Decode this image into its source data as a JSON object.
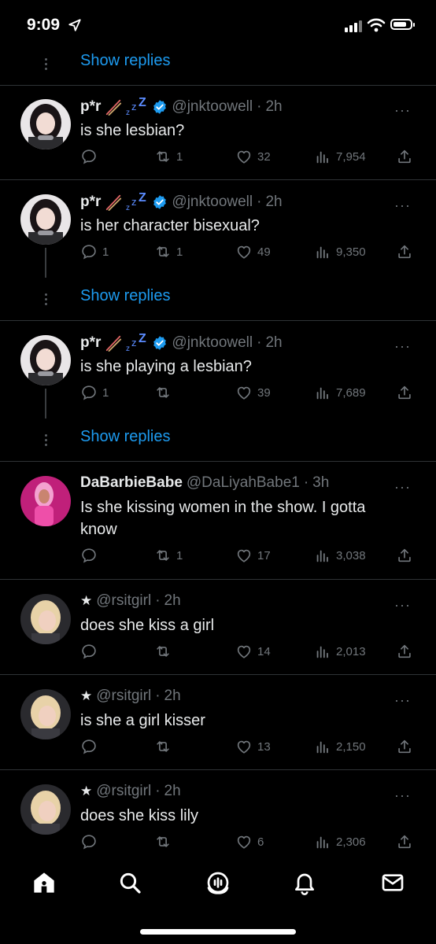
{
  "status": {
    "time": "9:09",
    "battery_level": 0.8
  },
  "show_replies_label": "Show replies",
  "tweets": [
    {
      "name": "p*r",
      "handle": "@jnktoowell",
      "time": "2h",
      "text": "is she lesbian?",
      "replies": "",
      "retweets": "1",
      "likes": "32",
      "views": "7,954"
    },
    {
      "name": "p*r",
      "handle": "@jnktoowell",
      "time": "2h",
      "text": "is her character bisexual?",
      "replies": "1",
      "retweets": "1",
      "likes": "49",
      "views": "9,350"
    },
    {
      "name": "p*r",
      "handle": "@jnktoowell",
      "time": "2h",
      "text": "is she playing a lesbian?",
      "replies": "1",
      "retweets": "",
      "likes": "39",
      "views": "7,689"
    },
    {
      "name": "DaBarbieBabe",
      "handle": "@DaLiyahBabe1",
      "time": "3h",
      "text": "Is she kissing women in the show. I gotta know",
      "replies": "",
      "retweets": "1",
      "likes": "17",
      "views": "3,038"
    },
    {
      "name": "★",
      "handle": "@rsitgirl",
      "time": "2h",
      "text": "does she kiss a girl",
      "replies": "",
      "retweets": "",
      "likes": "14",
      "views": "2,013"
    },
    {
      "name": "★",
      "handle": "@rsitgirl",
      "time": "2h",
      "text": "is she a girl kisser",
      "replies": "",
      "retweets": "",
      "likes": "13",
      "views": "2,150"
    },
    {
      "name": "★",
      "handle": "@rsitgirl",
      "time": "2h",
      "text": "does she kiss lily",
      "replies": "",
      "retweets": "",
      "likes": "6",
      "views": "2,306"
    }
  ],
  "dot_sep": "·",
  "more_glyph": "···",
  "colors": {
    "accent": "#1d9bf0",
    "muted": "#71767b",
    "divider": "#2f3336",
    "verified": "#1d9bf0"
  },
  "icons": {
    "reply": "reply-icon",
    "retweet": "retweet-icon",
    "like": "heart-icon",
    "views": "views-icon",
    "share": "share-icon",
    "home": "home-icon",
    "search": "search-icon",
    "spaces": "spaces-icon",
    "notifications": "bell-icon",
    "messages": "mail-icon"
  }
}
